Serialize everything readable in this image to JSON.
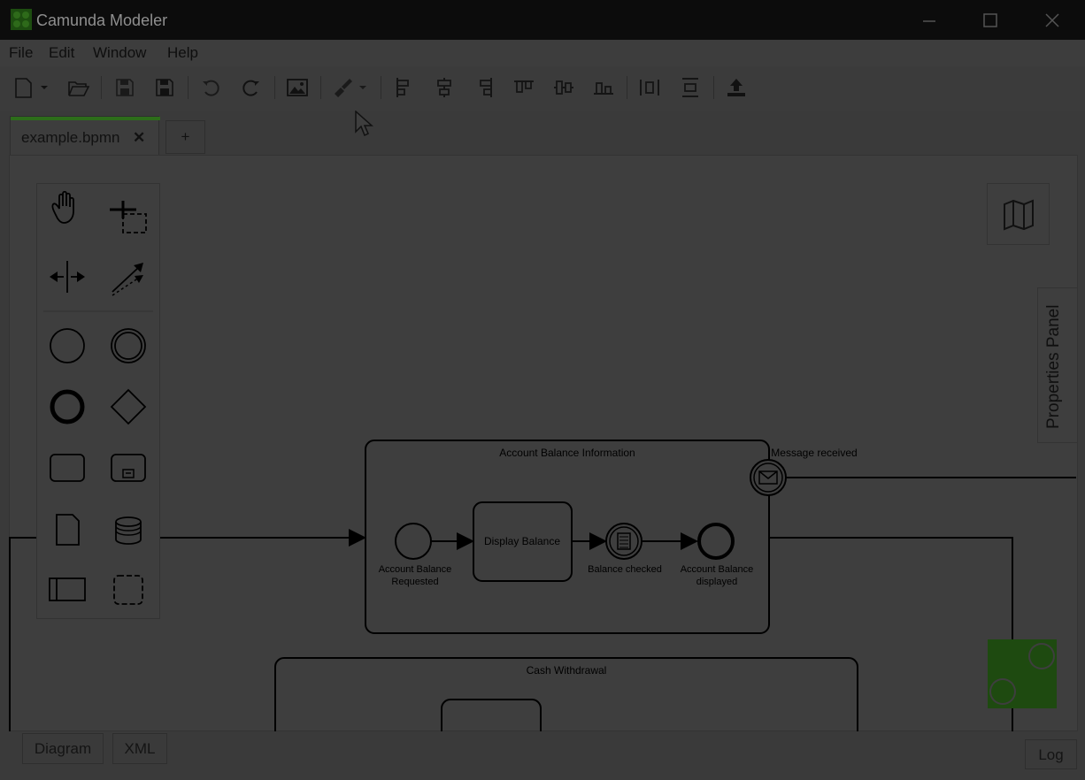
{
  "window": {
    "title": "Camunda Modeler",
    "controls": {
      "minimize": "minimize-icon",
      "maximize": "maximize-icon",
      "close": "close-icon"
    }
  },
  "menu": [
    "File",
    "Edit",
    "Window",
    "Help"
  ],
  "toolbar": {
    "icons": [
      "new-file-icon",
      "open-folder-icon",
      "save-icon",
      "save-as-icon",
      "undo-icon",
      "redo-icon",
      "export-image-icon",
      "color-picker-icon",
      "align-left-icon",
      "align-center-icon",
      "align-right-icon",
      "align-top-icon",
      "align-middle-icon",
      "align-bottom-icon",
      "distribute-horizontal-icon",
      "distribute-vertical-icon",
      "deploy-icon"
    ]
  },
  "tabs": [
    {
      "label": "example.bpmn",
      "close": "✕",
      "active": true
    }
  ],
  "add_tab": "+",
  "palette": {
    "tools": [
      "hand-tool-icon",
      "lasso-tool-icon",
      "space-tool-icon",
      "global-connect-tool-icon"
    ],
    "elements": [
      "start-event-icon",
      "intermediate-event-icon",
      "end-event-icon",
      "gateway-icon",
      "task-icon",
      "subprocess-icon",
      "data-object-icon",
      "data-store-icon",
      "participant-icon",
      "group-icon"
    ]
  },
  "diagram": {
    "subprocess_1": "Account Balance Information",
    "boundary_event": "Message received",
    "start_event_line1": "Account Balance",
    "start_event_line2": "Requested",
    "task": "Display Balance",
    "intermediate_event": "Balance checked",
    "end_event_line1": "Account Balance",
    "end_event_line2": "displayed",
    "subprocess_2": "Cash Withdrawal"
  },
  "properties_panel": "Properties Panel",
  "bottom": {
    "diagram": "Diagram",
    "xml": "XML",
    "log": "Log"
  },
  "colors": {
    "accent": "#2d6d1a",
    "titlebar": "#0c0c0c",
    "overlay_bg": "#3e3e3e"
  }
}
